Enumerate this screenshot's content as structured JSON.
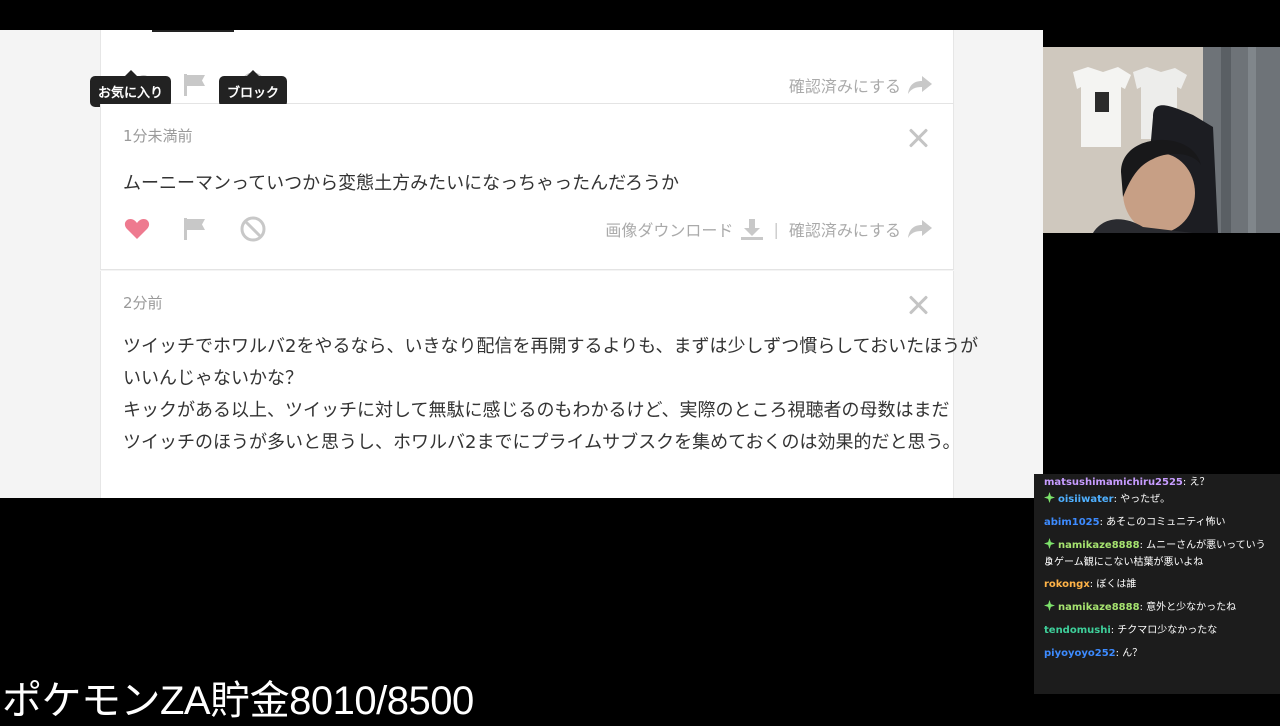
{
  "tooltips": {
    "favorite": "お気に入り",
    "block": "ブロック"
  },
  "cards": [
    {
      "confirm_label": "確認済みにする"
    },
    {
      "time": "1分未満前",
      "message": "ムーニーマンっていつから変態土方みたいになっちゃったんだろうか",
      "liked": true,
      "download_label": "画像ダウンロード",
      "divider": "|",
      "confirm_label": "確認済みにする"
    },
    {
      "time": "2分前",
      "lines": [
        "ツイッチでホワルバ2をやるなら、いきなり配信を再開するよりも、まずは少しずつ慣らしておいたほうが",
        "いいんじゃないかな？",
        "キックがある以上、ツイッチに対して無駄に感じるのもわかるけど、実際のところ視聴者の母数はまだ",
        "ツイッチのほうが多いと思うし、ホワルバ2までにプライムサブスクを集めておくのは効果的だと思う。"
      ]
    }
  ],
  "chat": {
    "messages": [
      {
        "user": "oisiiwater",
        "text": ": やったぜ。",
        "color": "#4fb0ff",
        "badge": true
      },
      {
        "user": "abim1025",
        "text": ": あそこのコミュニティ怖い",
        "color": "#3d8bff",
        "badge": false
      },
      {
        "user": "namikaze8888",
        "text": ": ムニーさんが悪いっていうよ",
        "text2": "りゲーム観にこない枯葉が悪いよね",
        "color": "#a6e36f",
        "badge": true
      },
      {
        "user": "rokongx",
        "text": ": ぼくは誰",
        "color": "#ffb347",
        "badge": false
      },
      {
        "user": "namikaze8888",
        "text": ": 意外と少なかったね",
        "color": "#a6e36f",
        "badge": true
      },
      {
        "user": "tendomushi",
        "text": ": チクマロ少なかったな",
        "color": "#3ecf9a",
        "badge": false
      },
      {
        "user": "piyoyoyo252",
        "text": ": ん？",
        "color": "#3d8bff",
        "badge": false
      },
      {
        "user": "matsushimamichiru2525",
        "text": ": え？",
        "color": "#c79cff",
        "badge": false
      }
    ]
  },
  "overlay": {
    "title": "ポケモンZA貯金8010/8500"
  },
  "colors": {
    "like_active": "#ee7a8f",
    "icon_inactive": "#c8c8c8",
    "badge": "#7de36b"
  }
}
